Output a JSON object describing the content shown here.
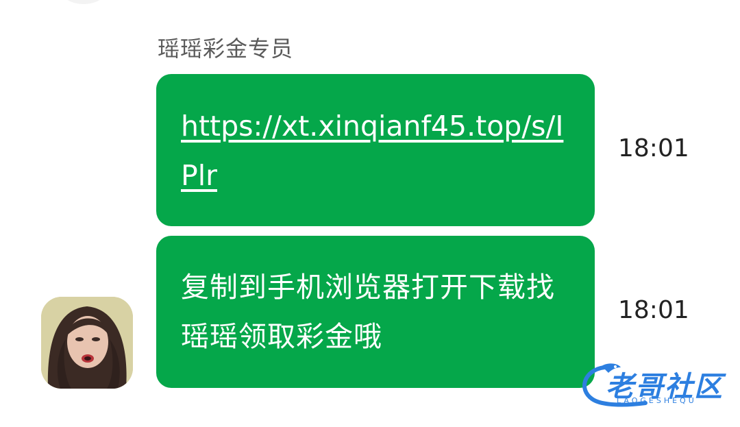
{
  "chat": {
    "sender_name": "瑶瑶彩金专员",
    "messages": [
      {
        "text": "https://xt.xinqianf45.top/s/IPlr",
        "time": "18:01",
        "is_link": true
      },
      {
        "text": "复制到手机浏览器打开下载找瑶瑶领取彩金哦",
        "time": "18:01",
        "is_link": false
      }
    ],
    "bubble_color": "#05a74a"
  },
  "watermark": {
    "title": "老哥社区",
    "subtitle": "LAOGESHEQU"
  }
}
